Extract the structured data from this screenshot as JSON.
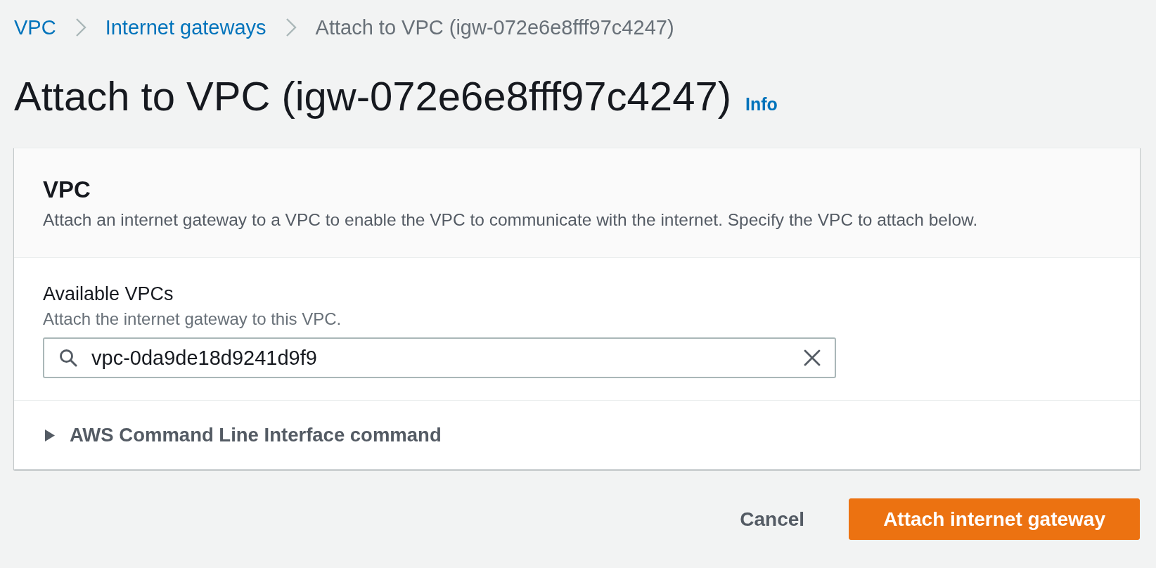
{
  "breadcrumbs": [
    {
      "label": "VPC",
      "kind": "link"
    },
    {
      "label": "Internet gateways",
      "kind": "link"
    },
    {
      "label": "Attach to VPC (igw-072e6e8fff97c4247)",
      "kind": "current"
    }
  ],
  "header": {
    "title": "Attach to VPC (igw-072e6e8fff97c4247)",
    "info_link": "Info"
  },
  "panel": {
    "title": "VPC",
    "description": "Attach an internet gateway to a VPC to enable the VPC to communicate with the internet. Specify the VPC to attach below.",
    "field": {
      "label": "Available VPCs",
      "hint": "Attach the internet gateway to this VPC.",
      "value": "vpc-0da9de18d9241d9f9"
    },
    "expander": {
      "label": "AWS Command Line Interface command",
      "expanded": false
    }
  },
  "actions": [
    {
      "label": "Cancel",
      "kind": "link"
    },
    {
      "label": "Attach internet gateway",
      "kind": "primary"
    }
  ]
}
